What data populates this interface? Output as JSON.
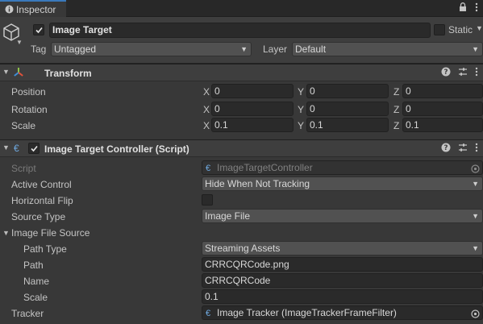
{
  "window": {
    "tab_title": "Inspector"
  },
  "gameobject": {
    "active": true,
    "name": "Image Target",
    "static_label": "Static",
    "tag_label": "Tag",
    "tag_value": "Untagged",
    "layer_label": "Layer",
    "layer_value": "Default"
  },
  "transform": {
    "title": "Transform",
    "rows": [
      {
        "label": "Position",
        "x": "0",
        "y": "0",
        "z": "0"
      },
      {
        "label": "Rotation",
        "x": "0",
        "y": "0",
        "z": "0"
      },
      {
        "label": "Scale",
        "x": "0.1",
        "y": "0.1",
        "z": "0.1"
      }
    ],
    "axis": {
      "x": "X",
      "y": "Y",
      "z": "Z"
    }
  },
  "controller": {
    "enabled": true,
    "title": "Image Target Controller (Script)",
    "script_label": "Script",
    "script_value": "ImageTargetController",
    "active_control_label": "Active Control",
    "active_control_value": "Hide When Not Tracking",
    "horizontal_flip_label": "Horizontal Flip",
    "horizontal_flip_value": false,
    "source_type_label": "Source Type",
    "source_type_value": "Image File",
    "image_file_source_label": "Image File Source",
    "path_type_label": "Path Type",
    "path_type_value": "Streaming Assets",
    "path_label": "Path",
    "path_value": "CRRCQRCode.png",
    "name_label": "Name",
    "name_value": "CRRCQRCode",
    "scale_label": "Scale",
    "scale_value": "0.1",
    "tracker_label": "Tracker",
    "tracker_value": "Image Tracker (ImageTrackerFrameFilter)"
  },
  "colors": {
    "accent": "#3a79bb",
    "panel": "#383838",
    "header": "#3e3e3e",
    "field": "#2a2a2a"
  }
}
